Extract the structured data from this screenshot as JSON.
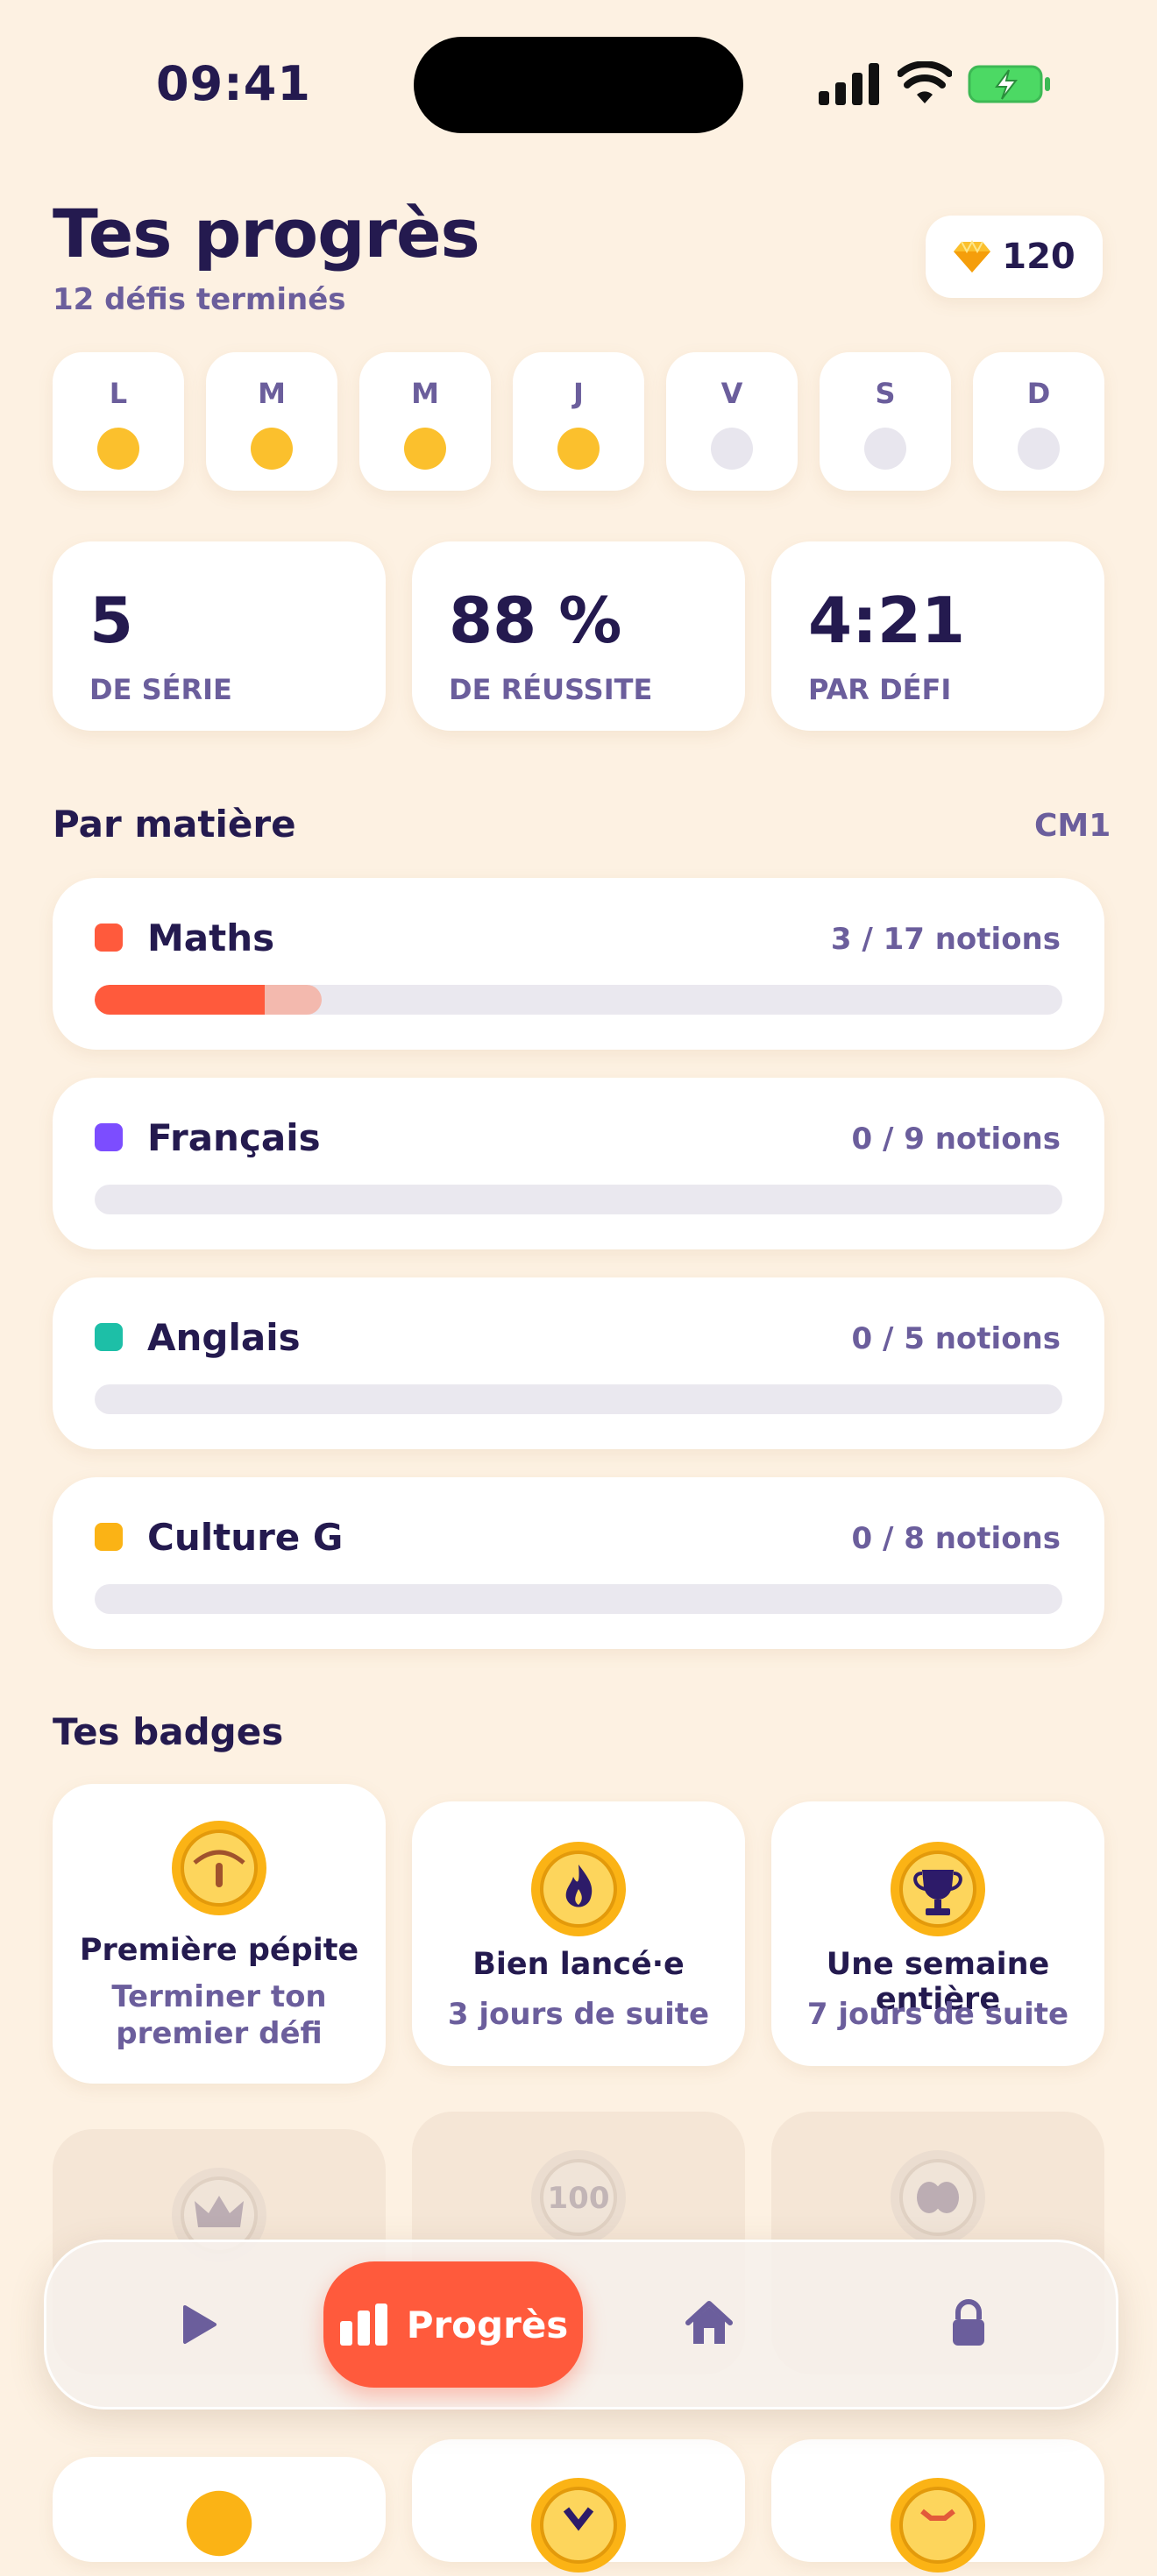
{
  "status_bar": {
    "time": "09:41"
  },
  "header": {
    "title": "Tes progrès",
    "subtitle": "12 défis terminés",
    "gems": "120"
  },
  "week": [
    {
      "label": "L",
      "done": true
    },
    {
      "label": "M",
      "done": true
    },
    {
      "label": "M",
      "done": true
    },
    {
      "label": "J",
      "done": true
    },
    {
      "label": "V",
      "done": false
    },
    {
      "label": "S",
      "done": false
    },
    {
      "label": "D",
      "done": false
    }
  ],
  "stats": [
    {
      "value": "5",
      "label": "DE SÉRIE"
    },
    {
      "value": "88 %",
      "label": "DE RÉUSSITE"
    },
    {
      "value": "4:21",
      "label": "PAR DÉFI"
    }
  ],
  "subjects_section": {
    "title": "Par matière",
    "grade": "CM1"
  },
  "subjects": [
    {
      "name": "Maths",
      "count": "3 / 17 notions",
      "color": "#FF5A3C",
      "done_fraction": 0.176,
      "in_progress_fraction": 0.235
    },
    {
      "name": "Français",
      "count": "0 / 9 notions",
      "color": "#7C4DFF",
      "done_fraction": 0,
      "in_progress_fraction": 0
    },
    {
      "name": "Anglais",
      "count": "0 / 5 notions",
      "color": "#1DBFA7",
      "done_fraction": 0,
      "in_progress_fraction": 0
    },
    {
      "name": "Culture G",
      "count": "0 / 8 notions",
      "color": "#FBB315",
      "done_fraction": 0,
      "in_progress_fraction": 0
    }
  ],
  "badges_section": {
    "title": "Tes badges"
  },
  "badges": [
    {
      "name": "Première pépite",
      "desc": "Terminer ton premier défi",
      "icon": "nugget-icon"
    },
    {
      "name": "Bien lancé·e",
      "desc": "3 jours de suite",
      "icon": "flame-icon"
    },
    {
      "name": "Une semaine entière",
      "desc": "7 jours de suite",
      "icon": "trophy-icon"
    }
  ],
  "locked_badges": [
    {
      "icon": "crown-icon",
      "text": ""
    },
    {
      "icon": "hundred-icon",
      "text": "100"
    },
    {
      "icon": "brain-icon",
      "text": ""
    }
  ],
  "tabbar": {
    "active_label": "Progrès"
  }
}
